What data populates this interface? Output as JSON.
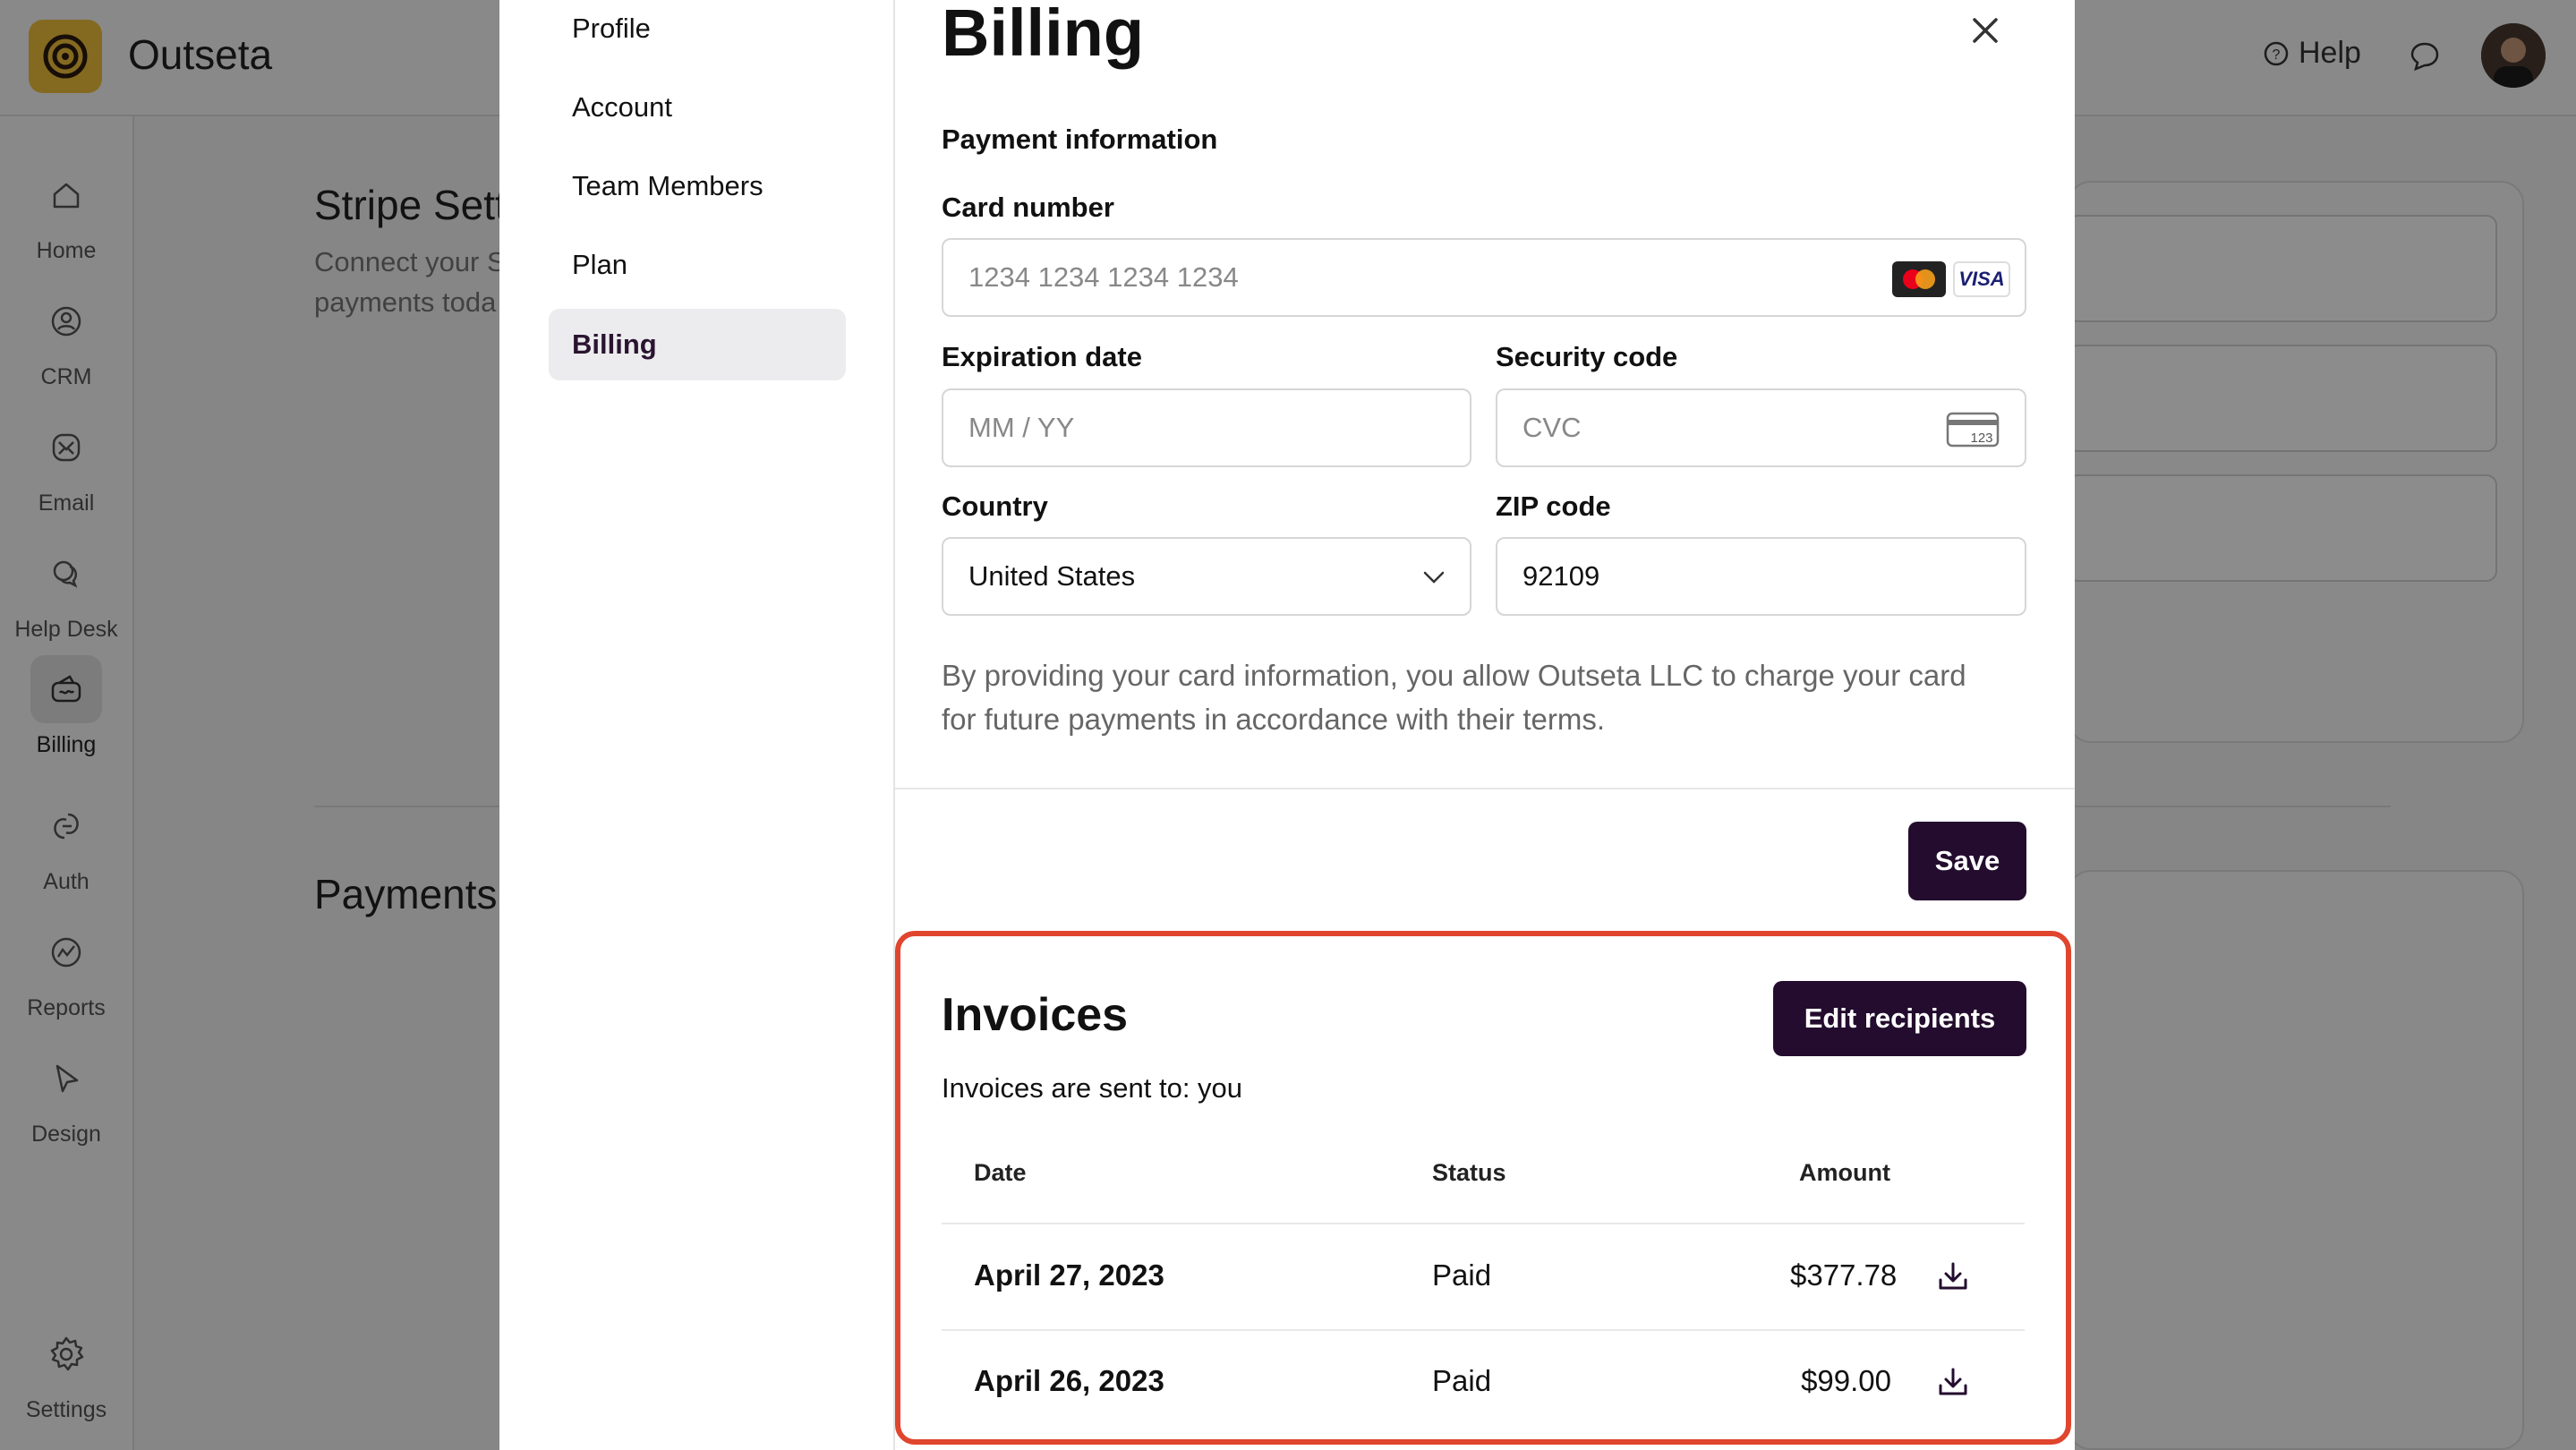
{
  "app": {
    "name": "Outseta",
    "help_label": "Help"
  },
  "sidebar": {
    "items": [
      {
        "label": "Home",
        "icon": "home-icon"
      },
      {
        "label": "CRM",
        "icon": "person-icon"
      },
      {
        "label": "Email",
        "icon": "mail-icon"
      },
      {
        "label": "Help Desk",
        "icon": "chat-bubbles-icon"
      },
      {
        "label": "Billing",
        "icon": "money-icon",
        "active": true
      },
      {
        "label": "Auth",
        "icon": "auth-icon"
      },
      {
        "label": "Reports",
        "icon": "chart-icon"
      },
      {
        "label": "Design",
        "icon": "cursor-icon"
      },
      {
        "label": "Settings",
        "icon": "gear-icon"
      }
    ]
  },
  "background": {
    "stripe_title": "Stripe Sett",
    "stripe_sub": "Connect your S payments toda",
    "payments_title": "Payments"
  },
  "modal": {
    "nav": [
      "Profile",
      "Account",
      "Team Members",
      "Plan",
      "Billing"
    ],
    "active_nav": "Billing",
    "title": "Billing",
    "section": "Payment information",
    "card_number": {
      "label": "Card number",
      "placeholder": "1234 1234 1234 1234"
    },
    "expiration": {
      "label": "Expiration date",
      "placeholder": "MM / YY"
    },
    "security": {
      "label": "Security code",
      "placeholder": "CVC",
      "icon_text": "123"
    },
    "country": {
      "label": "Country",
      "value": "United States"
    },
    "zip": {
      "label": "ZIP code",
      "value": "92109"
    },
    "consent": "By providing your card information, you allow Outseta LLC to charge your card for future payments in accordance with their terms.",
    "save_label": "Save",
    "card_brands": {
      "visa": "VISA"
    }
  },
  "invoices": {
    "title": "Invoices",
    "edit_label": "Edit recipients",
    "sent_to": "Invoices are sent to: you",
    "columns": {
      "date": "Date",
      "status": "Status",
      "amount": "Amount"
    },
    "rows": [
      {
        "date": "April 27, 2023",
        "status": "Paid",
        "amount": "$377.78"
      },
      {
        "date": "April 26, 2023",
        "status": "Paid",
        "amount": "$99.00"
      }
    ]
  },
  "colors": {
    "accent": "#230c2e",
    "highlight": "#e0452e",
    "logo": "#f0c23b"
  }
}
